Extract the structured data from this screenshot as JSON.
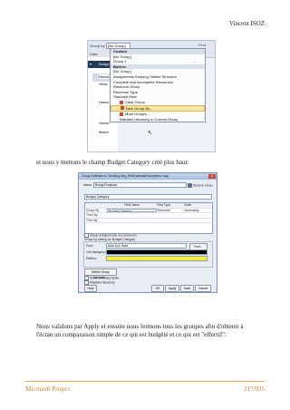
{
  "header": {
    "author": "Vincent ISOZ"
  },
  "footer": {
    "left": "Microsoft Project",
    "right": "217/935"
  },
  "screenshot1": {
    "group_by_label": "Group by:",
    "group_by_value": "[No Group]",
    "find_label": "Find",
    "data_label": "Data",
    "ellipsis": "...",
    "grid_rows": [
      "Budget",
      "Huma",
      "Vehic",
      "Huma",
      "Huma",
      "Machi"
    ],
    "menu": [
      {
        "label": "Custom",
        "kind": "header"
      },
      {
        "label": "[No Group]",
        "kind": "item"
      },
      {
        "label": "Group 1",
        "kind": "item"
      },
      {
        "label": "Built-In",
        "kind": "header"
      },
      {
        "label": "[No Group]",
        "kind": "item"
      },
      {
        "label": "Assignments Keeping Outline Structure",
        "kind": "item"
      },
      {
        "label": "Complete and Incomplete Resources",
        "kind": "item"
      },
      {
        "label": "Resource Group",
        "kind": "item"
      },
      {
        "label": "Resource Type",
        "kind": "item"
      },
      {
        "label": "Standard Rate",
        "kind": "item"
      },
      {
        "label": "Clear Group",
        "kind": "action"
      },
      {
        "label": "New Group By...",
        "kind": "selected"
      },
      {
        "label": "More Groups...",
        "kind": "action"
      },
      {
        "label": "Maintain Hierarchy in Current Group",
        "kind": "plain"
      }
    ]
  },
  "text1": "et nous y mettons le champ Budget Category créé plus haut:",
  "dialog": {
    "title": "Group Definition in 'Working Day_WithCalendarExceptions'.mpp",
    "name_label": "Name:",
    "name_value": "Budget Analysis",
    "show_in_menu": "Show in menu",
    "field_header": "Budget Category",
    "columns": [
      "",
      "Field Name",
      "Field Type",
      "Order"
    ],
    "rows": [
      [
        "Group By",
        "Budget Category",
        "Resource",
        "Ascending"
      ],
      [
        "Then By",
        "",
        "",
        ""
      ],
      [
        "Then By",
        "",
        "",
        ""
      ]
    ],
    "group_assign": "Group assignments, not resources",
    "settings_label": "Group by setting for Budget Category",
    "font_label": "Font:",
    "font_value": "Arial 8 pt, Bold",
    "font_button": "Font...",
    "cell_bg_label": "Cell background:",
    "pattern_label": "Pattern:",
    "define_intervals": "Define Group Intervals...",
    "show_summary": "Show summary tasks",
    "maintain_hierarchy": "Maintain hierarchy",
    "buttons": [
      "Help",
      "OK",
      "Apply",
      "Save",
      "Cancel"
    ]
  },
  "text2": "Nous validons par Apply et ensuite nous fermons tous les groupes afin d'obtenir à l'écran un comparaison simple de ce qui est budgété et ce qui est \"effectif\":"
}
